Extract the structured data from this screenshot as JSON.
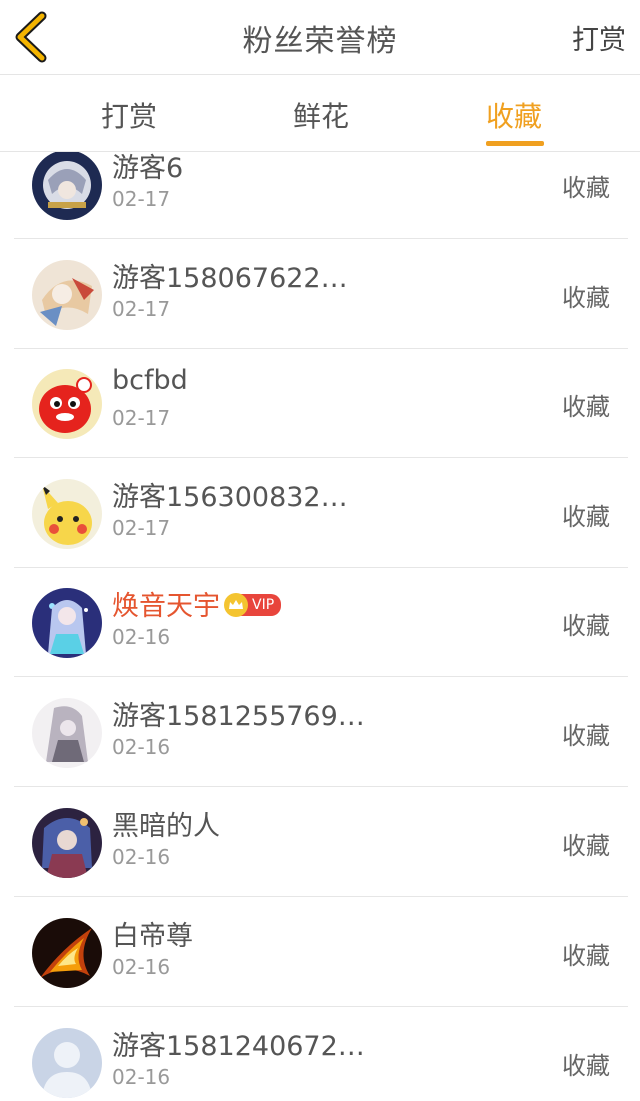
{
  "header": {
    "title": "粉丝荣誉榜",
    "action_label": "打赏"
  },
  "tabs": [
    {
      "label": "打赏",
      "active": false
    },
    {
      "label": "鲜花",
      "active": false
    },
    {
      "label": "收藏",
      "active": true
    }
  ],
  "colors": {
    "accent": "#f0a020",
    "vip_name": "#e5552f",
    "vip_badge": "#e8453c"
  },
  "fans": [
    {
      "name": "游客6",
      "date": "02-17",
      "action": "收藏",
      "avatar": "anime-avatar"
    },
    {
      "name": "游客158067622…",
      "date": "02-17",
      "action": "收藏",
      "avatar": "anime-avatar"
    },
    {
      "name": "bcfbd",
      "date": "02-17",
      "action": "收藏",
      "avatar": "red-mascot-avatar"
    },
    {
      "name": "游客156300832…",
      "date": "02-17",
      "action": "收藏",
      "avatar": "pikachu-avatar"
    },
    {
      "name": "焕音天宇",
      "date": "02-16",
      "action": "收藏",
      "avatar": "anime-avatar",
      "vip": true,
      "vip_label": "VIP"
    },
    {
      "name": "游客1581255769…",
      "date": "02-16",
      "action": "收藏",
      "avatar": "anime-avatar"
    },
    {
      "name": "黑暗的人",
      "date": "02-16",
      "action": "收藏",
      "avatar": "anime-avatar"
    },
    {
      "name": "白帝尊",
      "date": "02-16",
      "action": "收藏",
      "avatar": "fire-avatar"
    },
    {
      "name": "游客1581240672…",
      "date": "02-16",
      "action": "收藏",
      "avatar": "default-user-avatar"
    }
  ]
}
